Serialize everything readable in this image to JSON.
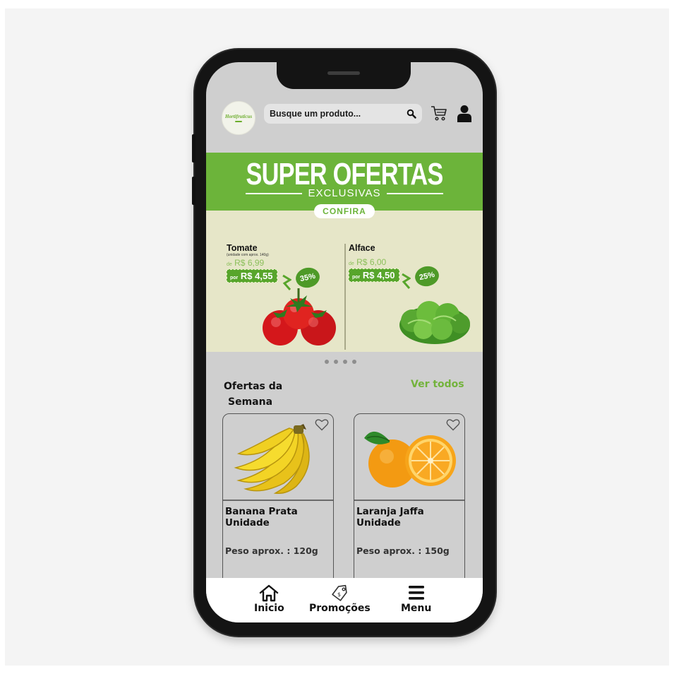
{
  "header": {
    "logo_text": "Hortifruticus",
    "search_placeholder": "Busque um produto...",
    "icons": [
      "search-icon",
      "cart-icon",
      "user-icon"
    ]
  },
  "banner": {
    "title": "SUPER OFERTAS",
    "subtitle": "EXCLUSIVAS",
    "cta": "CONFIRA"
  },
  "carousel": {
    "slides": [
      {
        "name": "Tomate",
        "note": "(unidade com aprox. 140g)",
        "old_prefix": "de",
        "old_price": "R$ 6,99",
        "new_prefix": "por",
        "new_price": "R$ 4,55",
        "discount": "35%"
      },
      {
        "name": "Alface",
        "note": "",
        "old_prefix": "de",
        "old_price": "R$ 6,00",
        "new_prefix": "por",
        "new_price": "R$ 4,50",
        "discount": "25%"
      }
    ],
    "dots": 4
  },
  "offers": {
    "title_line1": "Ofertas da",
    "title_line2": "Semana",
    "see_all": "Ver todos",
    "products": [
      {
        "name_line1": "Banana Prata",
        "name_line2": "Unidade",
        "weight": "Peso aprox. : 120g"
      },
      {
        "name_line1": "Laranja Jaffa",
        "name_line2": "Unidade",
        "weight": "Peso aprox. : 150g"
      }
    ]
  },
  "nav": {
    "items": [
      {
        "label": "Inicio",
        "icon": "home-icon"
      },
      {
        "label": "Promoções",
        "icon": "tag-icon"
      },
      {
        "label": "Menu",
        "icon": "menu-icon"
      }
    ]
  },
  "colors": {
    "brand_green": "#6cb43a",
    "dark_green": "#57a52b",
    "carousel_bg": "#e6e6c8",
    "screen_bg": "#cfcfcf"
  }
}
